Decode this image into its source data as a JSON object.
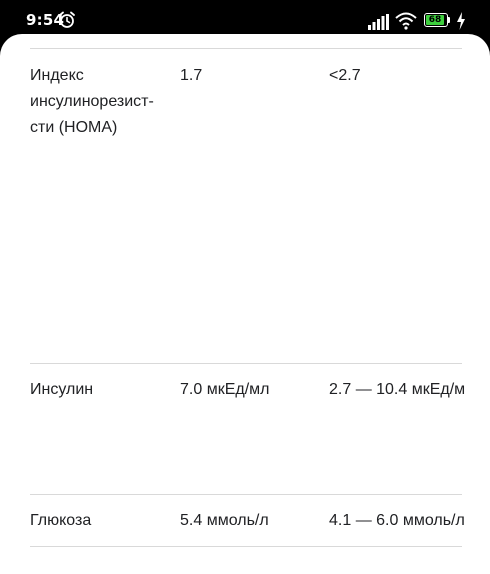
{
  "status_bar": {
    "time": "9:54",
    "battery_level": "68"
  },
  "table": {
    "rows": [
      {
        "name": "Индекс инсулинорезист-сти (HOMA)",
        "value": "1.7",
        "reference": "<2.7"
      },
      {
        "name": "Инсулин",
        "value": "7.0 мкЕд/мл",
        "reference": "2.7 — 10.4 мкЕд/м"
      },
      {
        "name": "Глюкоза",
        "value": "5.4 ммоль/л",
        "reference": "4.1 — 6.0 ммоль/л"
      }
    ]
  }
}
